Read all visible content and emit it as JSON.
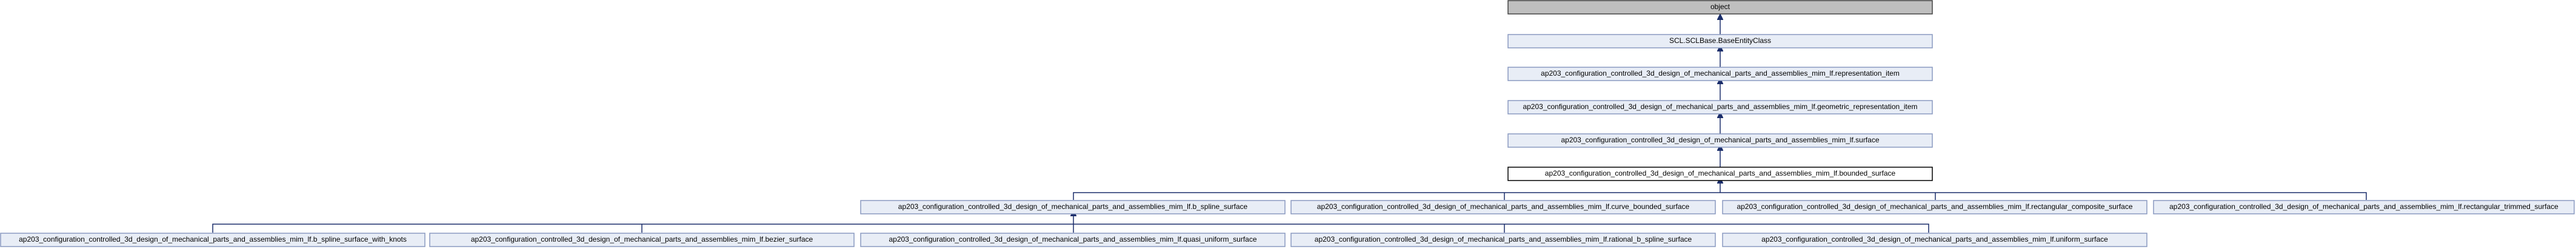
{
  "nodes": {
    "object": "object",
    "base_entity": "SCL.SCLBase.BaseEntityClass",
    "representation_item": "ap203_configuration_controlled_3d_design_of_mechanical_parts_and_assemblies_mim_lf.representation_item",
    "geometric_representation_item": "ap203_configuration_controlled_3d_design_of_mechanical_parts_and_assemblies_mim_lf.geometric_representation_item",
    "surface": "ap203_configuration_controlled_3d_design_of_mechanical_parts_and_assemblies_mim_lf.surface",
    "bounded_surface": "ap203_configuration_controlled_3d_design_of_mechanical_parts_and_assemblies_mim_lf.bounded_surface",
    "b_spline_surface": "ap203_configuration_controlled_3d_design_of_mechanical_parts_and_assemblies_mim_lf.b_spline_surface",
    "curve_bounded_surface": "ap203_configuration_controlled_3d_design_of_mechanical_parts_and_assemblies_mim_lf.curve_bounded_surface",
    "rectangular_composite_surface": "ap203_configuration_controlled_3d_design_of_mechanical_parts_and_assemblies_mim_lf.rectangular_composite_surface",
    "rectangular_trimmed_surface": "ap203_configuration_controlled_3d_design_of_mechanical_parts_and_assemblies_mim_lf.rectangular_trimmed_surface",
    "b_spline_surface_with_knots": "ap203_configuration_controlled_3d_design_of_mechanical_parts_and_assemblies_mim_lf.b_spline_surface_with_knots",
    "bezier_surface": "ap203_configuration_controlled_3d_design_of_mechanical_parts_and_assemblies_mim_lf.bezier_surface",
    "quasi_uniform_surface": "ap203_configuration_controlled_3d_design_of_mechanical_parts_and_assemblies_mim_lf.quasi_uniform_surface",
    "rational_b_spline_surface": "ap203_configuration_controlled_3d_design_of_mechanical_parts_and_assemblies_mim_lf.rational_b_spline_surface",
    "uniform_surface": "ap203_configuration_controlled_3d_design_of_mechanical_parts_and_assemblies_mim_lf.uniform_surface"
  },
  "colors": {
    "node_fill": "#e8edf6",
    "node_border": "#8a9ac0",
    "root_fill": "#bfbfbf",
    "focus_fill": "#ffffff",
    "edge": "#1a2d6a"
  }
}
